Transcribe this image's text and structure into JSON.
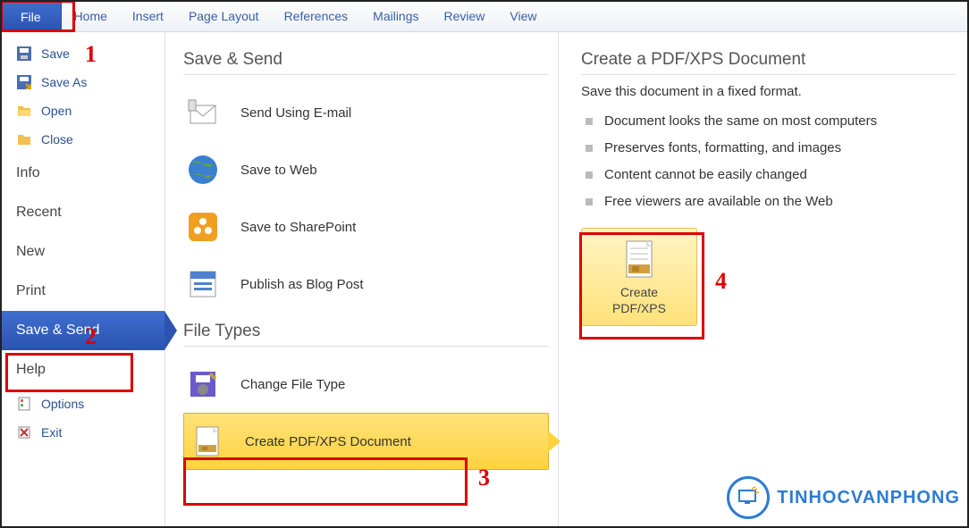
{
  "ribbon": {
    "file": "File",
    "tabs": [
      "Home",
      "Insert",
      "Page Layout",
      "References",
      "Mailings",
      "Review",
      "View"
    ]
  },
  "sidebar": {
    "top": [
      {
        "icon": "save",
        "label": "Save"
      },
      {
        "icon": "saveas",
        "label": "Save As"
      },
      {
        "icon": "open",
        "label": "Open"
      },
      {
        "icon": "close",
        "label": "Close"
      }
    ],
    "mid": [
      "Info",
      "Recent",
      "New",
      "Print",
      "Save & Send",
      "Help"
    ],
    "selected_index": 4,
    "bottom": [
      {
        "icon": "options",
        "label": "Options"
      },
      {
        "icon": "exit",
        "label": "Exit"
      }
    ]
  },
  "middle": {
    "section1_title": "Save & Send",
    "section1_items": [
      {
        "icon": "envelope",
        "label": "Send Using E-mail"
      },
      {
        "icon": "globe",
        "label": "Save to Web"
      },
      {
        "icon": "sharepoint",
        "label": "Save to SharePoint"
      },
      {
        "icon": "blog",
        "label": "Publish as Blog Post"
      }
    ],
    "section2_title": "File Types",
    "section2_items": [
      {
        "icon": "floppy",
        "label": "Change File Type"
      },
      {
        "icon": "pdfdoc",
        "label": "Create PDF/XPS Document",
        "active": true
      }
    ]
  },
  "right": {
    "title": "Create a PDF/XPS Document",
    "desc": "Save this document in a fixed format.",
    "bullets": [
      "Document looks the same on most computers",
      "Preserves fonts, formatting, and images",
      "Content cannot be easily changed",
      "Free viewers are available on the Web"
    ],
    "button_label_l1": "Create",
    "button_label_l2": "PDF/XPS"
  },
  "logo_text": "TINHOCVANPHONG",
  "annotations": [
    "1",
    "2",
    "3",
    "4"
  ]
}
